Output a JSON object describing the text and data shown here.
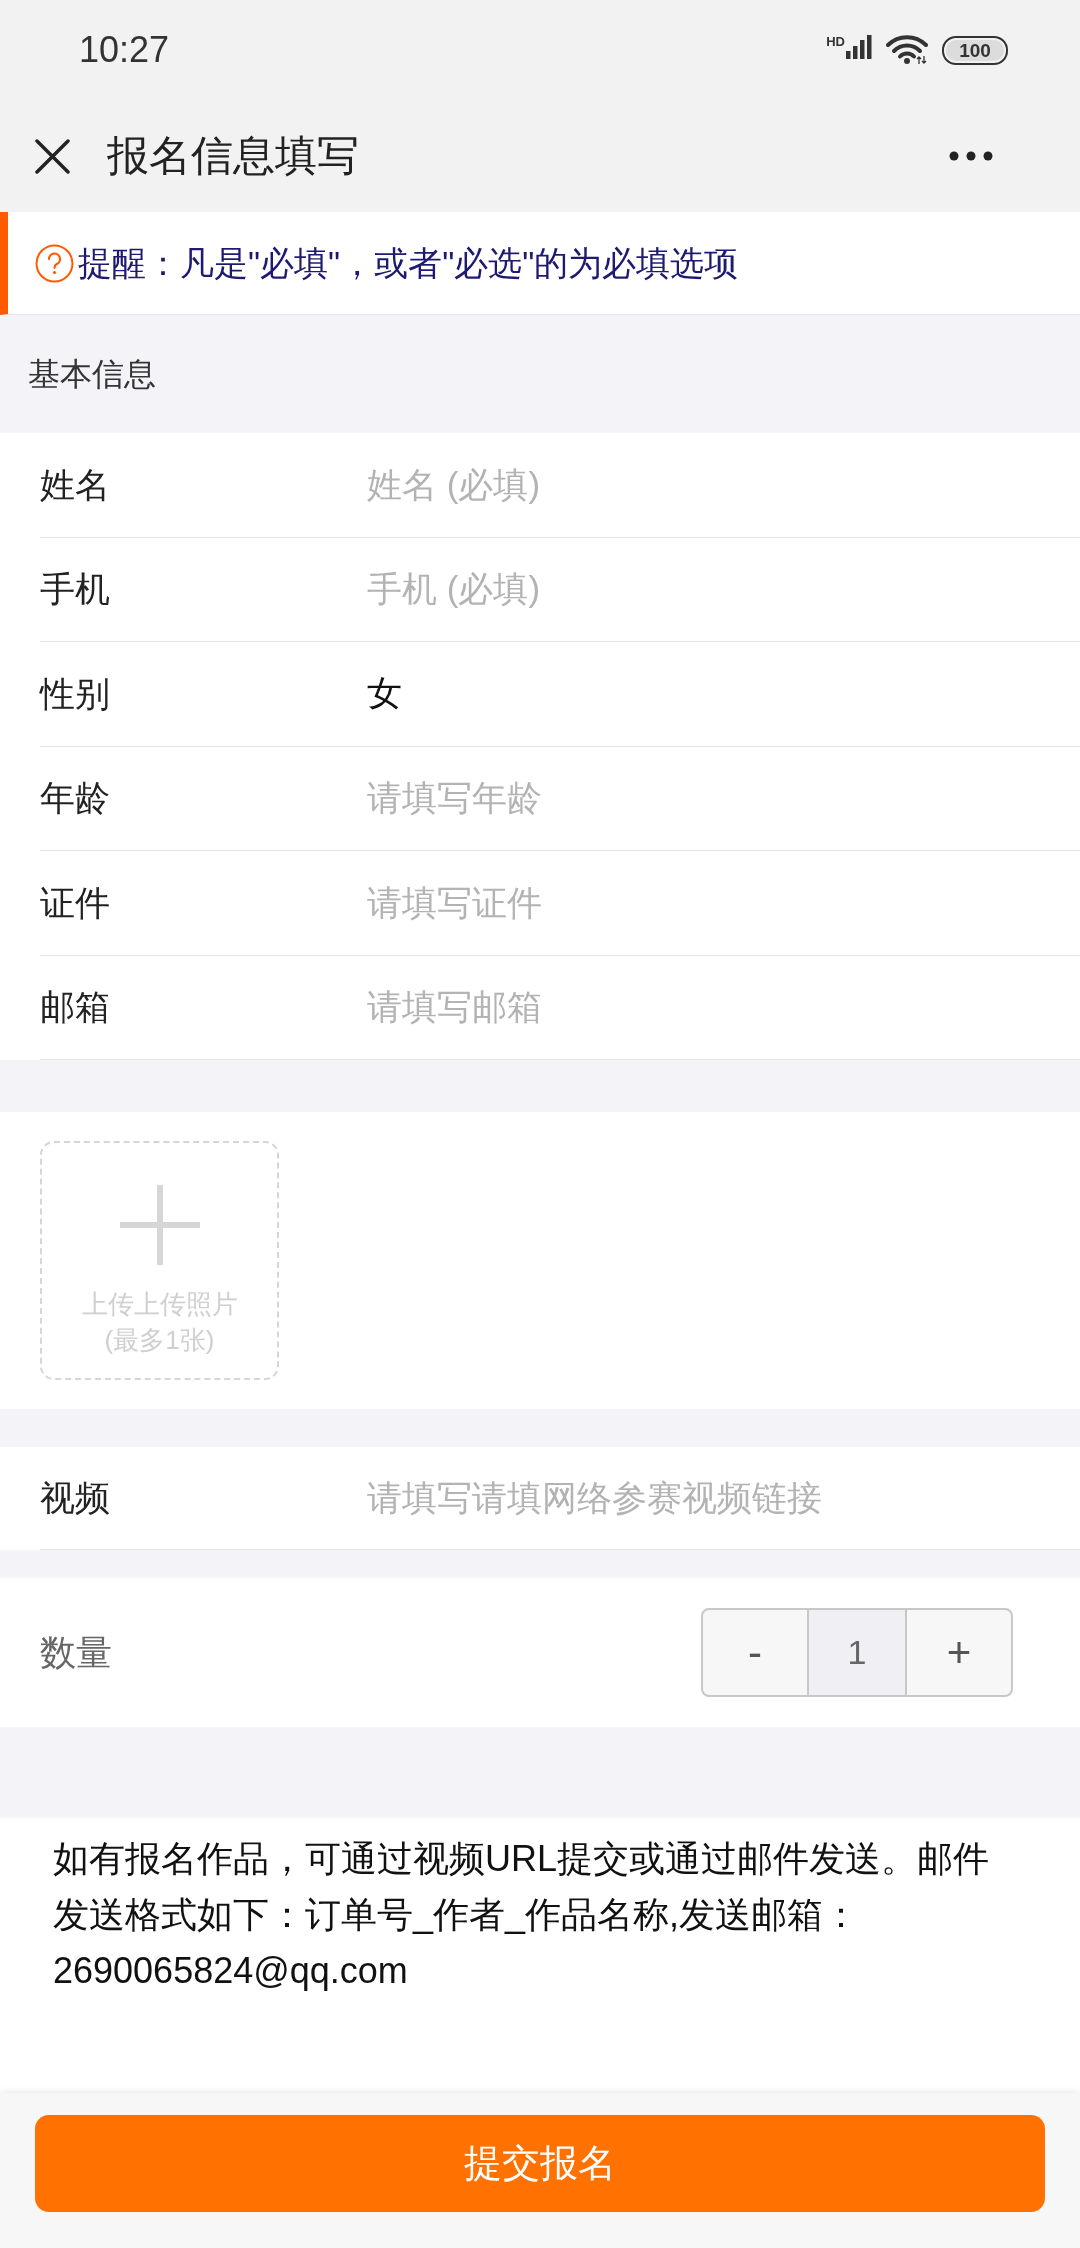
{
  "status_bar": {
    "time": "10:27",
    "network_type": "HD",
    "battery": "100"
  },
  "header": {
    "title": "报名信息填写"
  },
  "notice": {
    "text": "提醒：凡是\"必填\"，或者\"必选\"的为必填选项"
  },
  "section": {
    "title": "基本信息"
  },
  "fields": [
    {
      "kind": "input",
      "label": "姓名",
      "placeholder": "姓名 (必填)"
    },
    {
      "kind": "input",
      "label": "手机",
      "placeholder": "手机 (必填)"
    },
    {
      "kind": "select",
      "label": "性别",
      "value": "女"
    },
    {
      "kind": "input",
      "label": "年龄",
      "placeholder": "请填写年龄"
    },
    {
      "kind": "input",
      "label": "证件",
      "placeholder": "请填写证件"
    },
    {
      "kind": "input",
      "label": "邮箱",
      "placeholder": "请填写邮箱"
    }
  ],
  "upload": {
    "label": "上传上传照片",
    "hint": "(最多1张)"
  },
  "video_field": {
    "label": "视频",
    "placeholder": "请填写请填网络参赛视频链接"
  },
  "quantity": {
    "label": "数量",
    "decrement": "-",
    "value": "1",
    "increment": "+"
  },
  "note": {
    "text": "如有报名作品，可通过视频URL提交或通过邮件发送。邮件发送格式如下：订单号_作者_作品名称,发送邮箱：2690065824@qq.com"
  },
  "submit_button": {
    "label": "提交报名"
  }
}
